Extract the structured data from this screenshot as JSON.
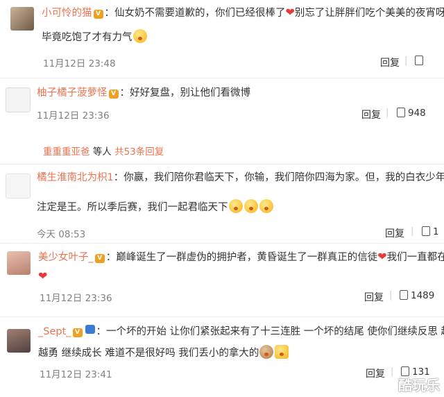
{
  "comments": [
    {
      "user": "小可怜的猫",
      "line1": "：仙女奶不需要道歉的，你们已经很棒了",
      "line1b": "别忘了让胖胖们吃个美美的夜宵呀，",
      "line2": "毕竟吃饱了才有力气",
      "time": "11月12日 23:48",
      "reply": "回复",
      "likes": ""
    },
    {
      "user": "柚子橘子菠萝怪",
      "line1": "：好好复盘，别让他们看微博",
      "time": "11月12日 23:36",
      "reply": "回复",
      "likes": "948",
      "more_user": "重重重亚爸",
      "more_text": " 等人 ",
      "more_count": "共53条回复"
    },
    {
      "user": "橘生淮南北为枳1",
      "line1": "：你赢，我们陪你君临天下，你输，我们陪你四海为家。但，我的白衣少年们，",
      "line2": "注定是王。所以季后赛，我们一起君临天下",
      "time": "今天 08:53",
      "reply": "回复",
      "likes": "1"
    },
    {
      "user": "美少女叶子_",
      "line1": "：巅峰诞生了一群虚伪的拥护者，黄昏诞生了一群真正的信徒",
      "line1b": "我们一直都在",
      "time": "11月12日 23:36",
      "reply": "回复",
      "likes": "1489"
    },
    {
      "user": "_Sept_",
      "line1": "：一个坏的开始 让你们紧张起来有了十三连胜 一个坏的结尾 使你们继续反思 越战",
      "line2": "越勇 继续成长 难道不是很好吗 我们丢小的拿大的",
      "time": "11月12日 23:41",
      "reply": "回复",
      "likes": "131"
    }
  ],
  "vip_badge": "V",
  "separator": "|",
  "heart_icon": "❤",
  "watermark": "酷玩乐",
  "colors": {
    "nickname": "#eb7350",
    "time": "#808080",
    "heart": "#e83a3a"
  }
}
